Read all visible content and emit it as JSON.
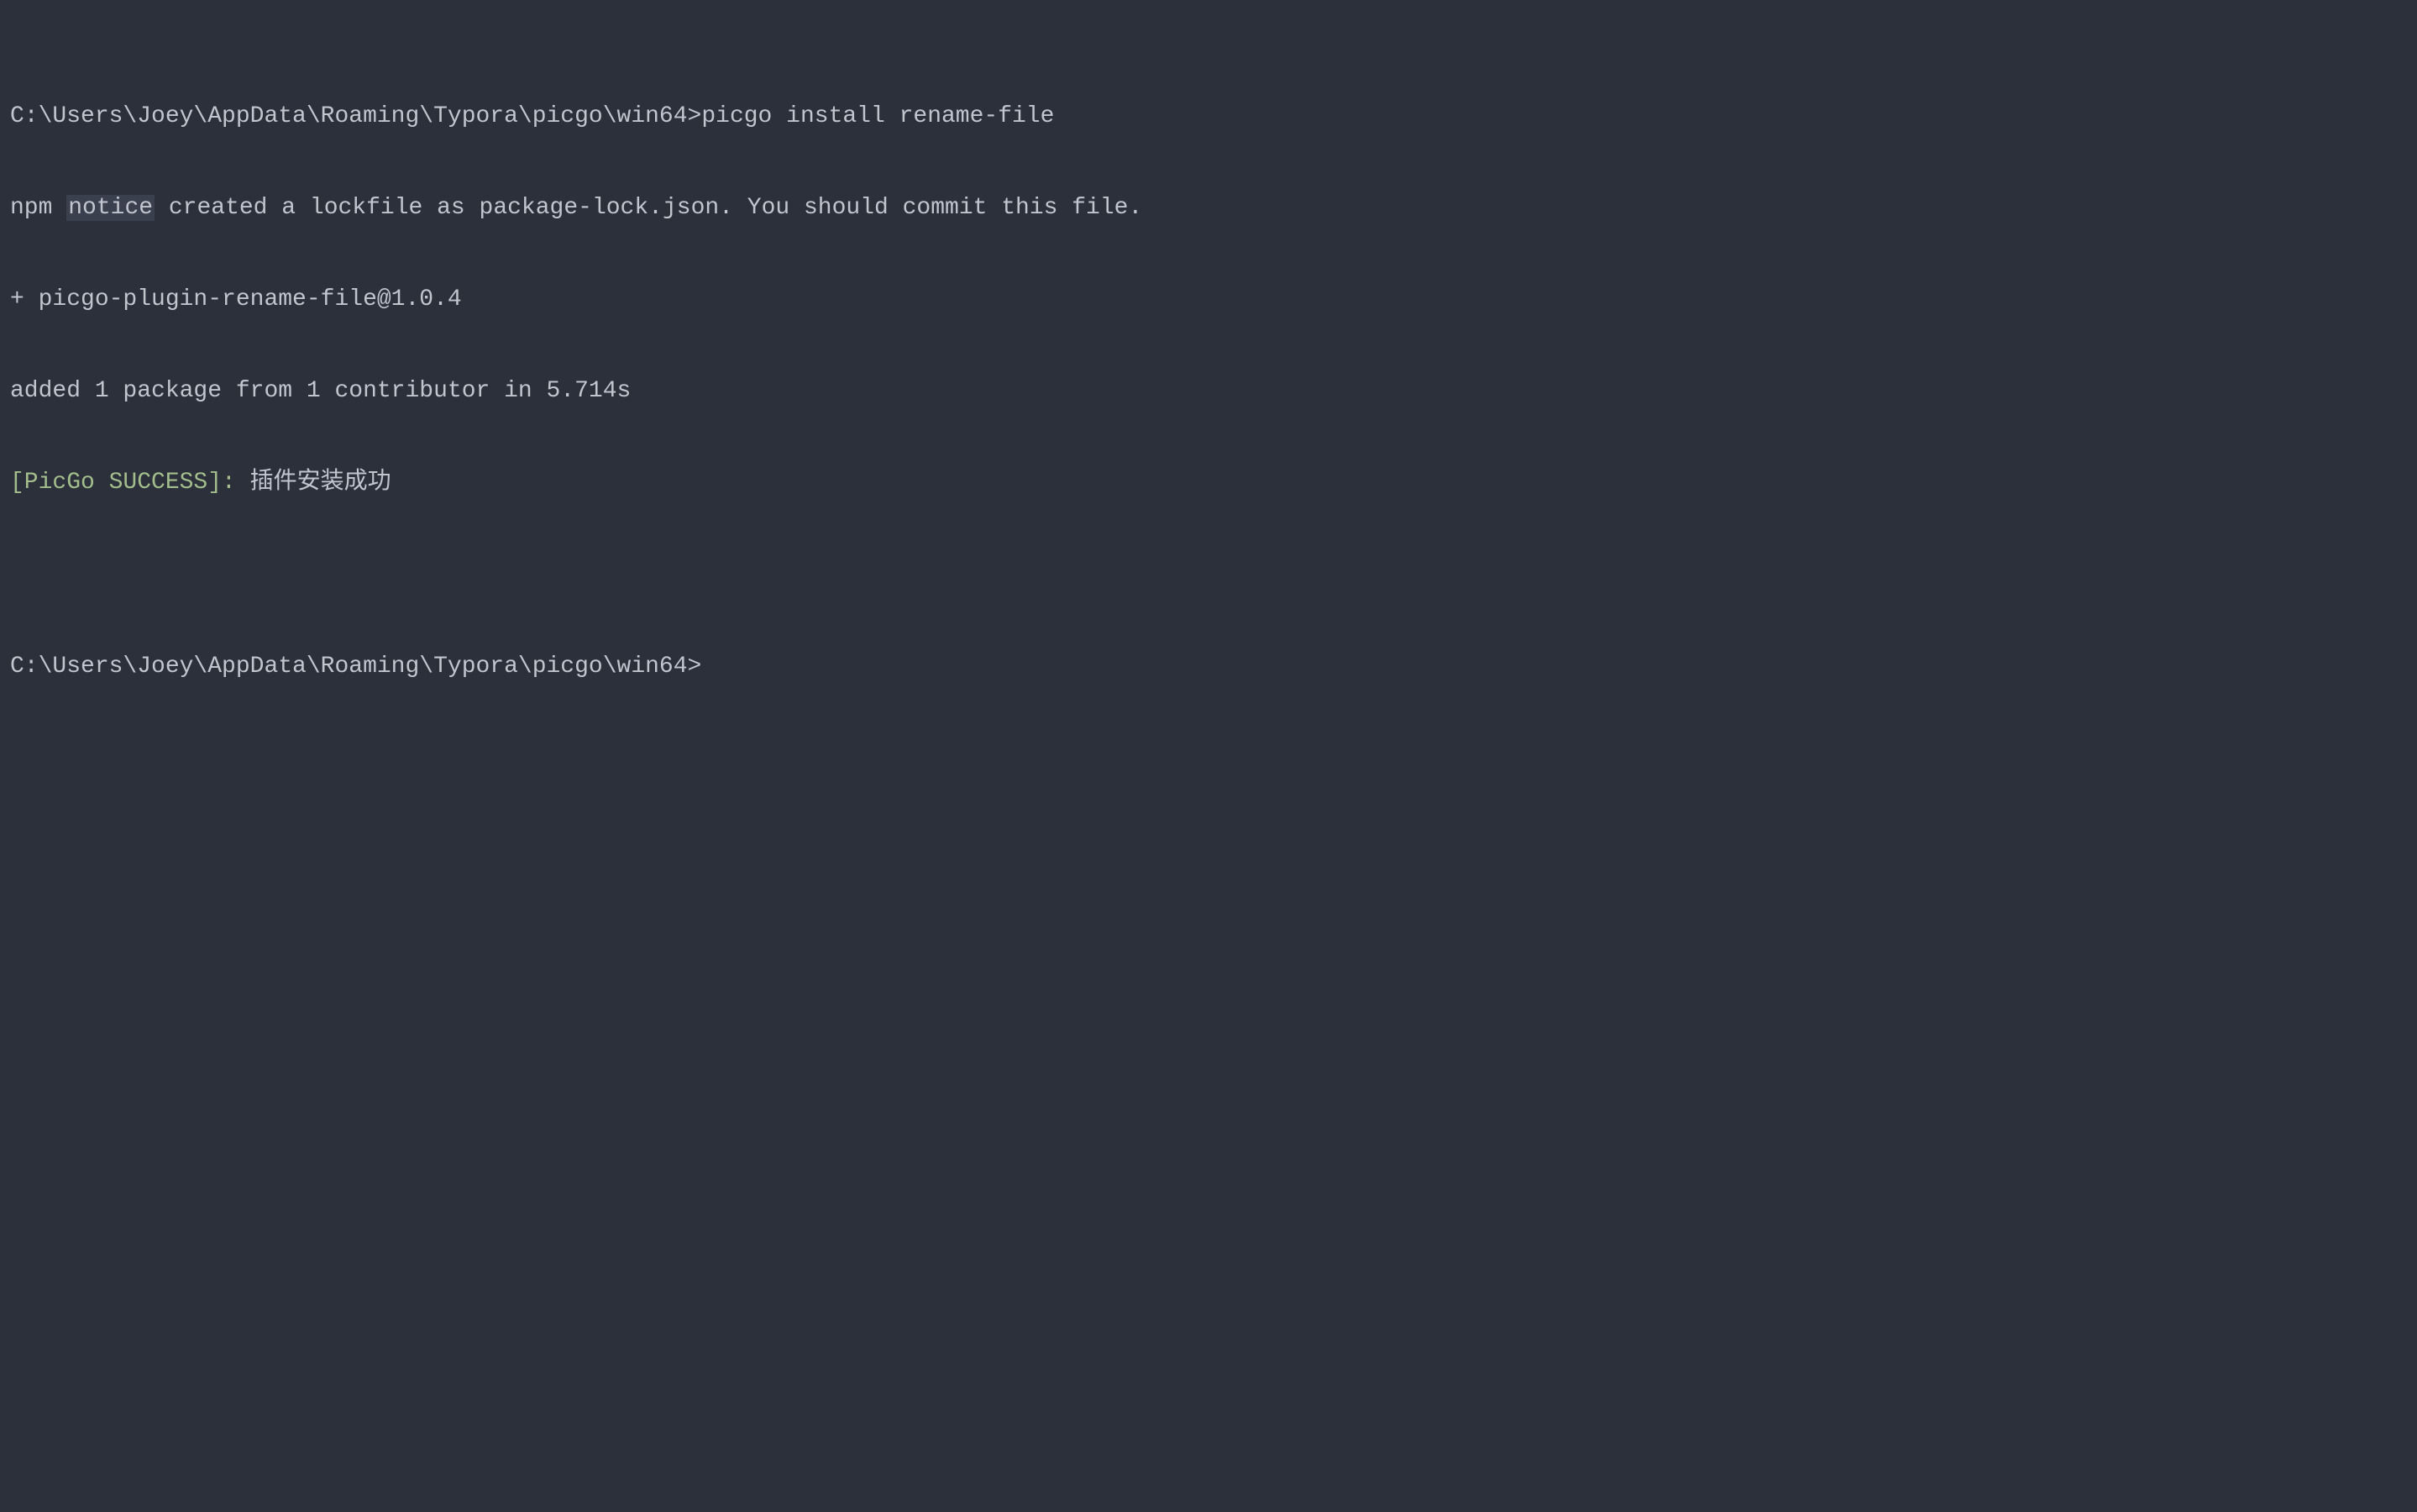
{
  "terminal": {
    "line1": {
      "prompt": "C:\\Users\\Joey\\AppData\\Roaming\\Typora\\picgo\\win64>",
      "command": "picgo install rename-file"
    },
    "line2": {
      "npm": "npm",
      "level": "notice",
      "message": " created a lockfile as package-lock.json. You should commit this file."
    },
    "line3": "+ picgo-plugin-rename-file@1.0.4",
    "line4": "added 1 package from 1 contributor in 5.714s",
    "line5": {
      "tag": "[PicGo SUCCESS]:",
      "message": " 插件安装成功"
    },
    "line6_prompt": "C:\\Users\\Joey\\AppData\\Roaming\\Typora\\picgo\\win64>"
  }
}
